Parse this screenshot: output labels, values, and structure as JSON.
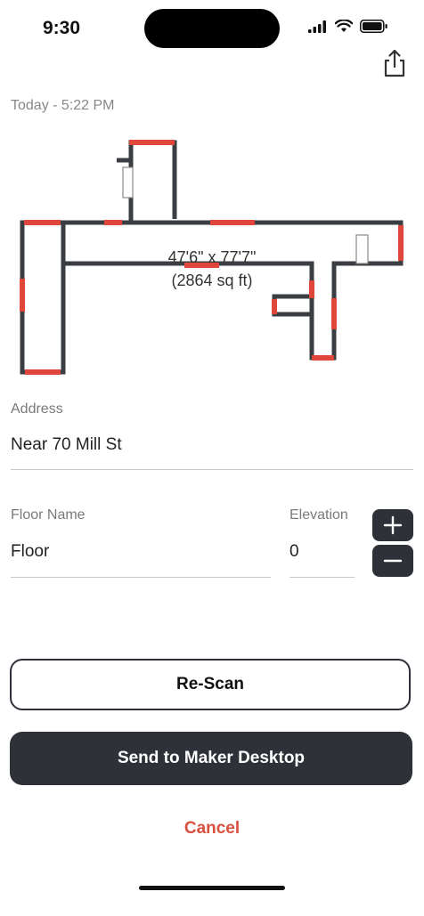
{
  "status_bar": {
    "time": "9:30"
  },
  "header": {
    "timestamp": "Today - 5:22 PM",
    "share_icon": "share-icon"
  },
  "floor_plan": {
    "dimensions": "47'6\" x 77'7\"",
    "area": "(2864 sq ft)",
    "wall_color": "#3a3d42",
    "opening_color": "#e0473a"
  },
  "form": {
    "address_label": "Address",
    "address_value": "Near 70 Mill St",
    "floor_name_label": "Floor Name",
    "floor_name_value": "Floor",
    "elevation_label": "Elevation",
    "elevation_value": "0",
    "increment_icon": "plus-icon",
    "decrement_icon": "minus-icon"
  },
  "actions": {
    "rescan_label": "Re-Scan",
    "send_label": "Send to Maker Desktop",
    "cancel_label": "Cancel"
  },
  "colors": {
    "primary_dark": "#2e3238",
    "cancel_red": "#d9503f"
  }
}
